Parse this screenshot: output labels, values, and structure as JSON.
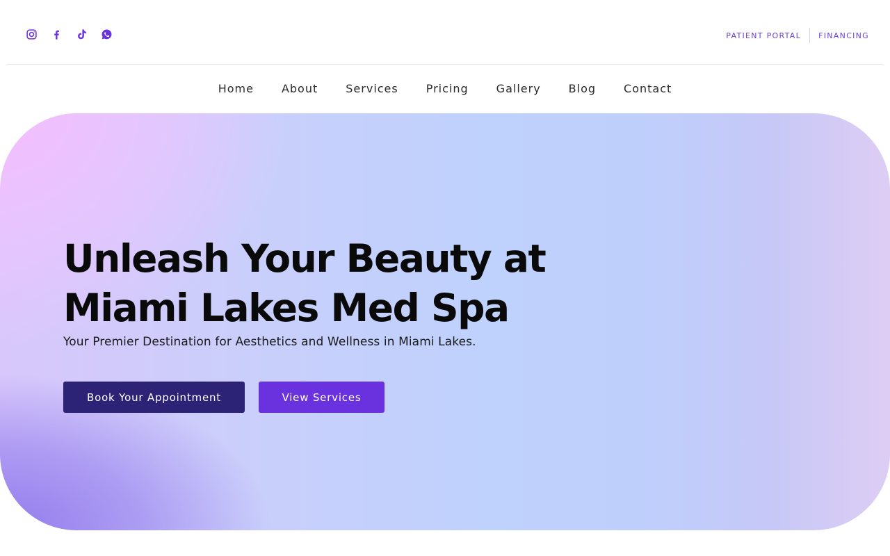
{
  "social": [
    {
      "name": "instagram-icon"
    },
    {
      "name": "facebook-icon"
    },
    {
      "name": "tiktok-icon"
    },
    {
      "name": "whatsapp-icon"
    }
  ],
  "top_links": {
    "patient_portal": "PATIENT PORTAL",
    "financing": "FINANCING"
  },
  "nav": {
    "items": [
      "Home",
      "About",
      "Services",
      "Pricing",
      "Gallery",
      "Blog",
      "Contact"
    ]
  },
  "hero": {
    "title_line1": "Unleash Your Beauty at",
    "title_line2": "Miami Lakes Med Spa",
    "subtitle": "Your Premier Destination for Aesthetics and Wellness in Miami Lakes.",
    "primary_button": "Book Your Appointment",
    "secondary_button": "View Services"
  },
  "colors": {
    "accent": "#6a31de",
    "primary_button": "#2c2276",
    "link": "#6b3fd4"
  }
}
